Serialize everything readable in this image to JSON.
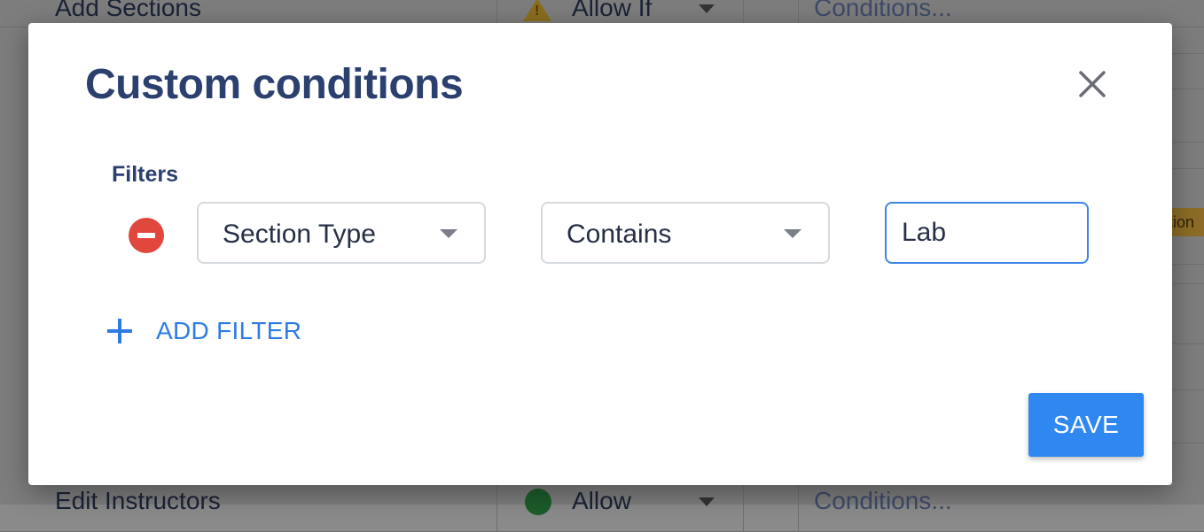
{
  "background": {
    "rows": [
      {
        "label": "Add Sections",
        "permission": "Allow If",
        "conditions": "Conditions...",
        "status_icon": "warning-icon"
      },
      {
        "label": "Edit Instructors",
        "permission": "Allow",
        "conditions": "Conditions...",
        "status_icon": "check-circle-icon"
      }
    ],
    "side_tag": "tion"
  },
  "modal": {
    "title": "Custom conditions",
    "filters_label": "Filters",
    "filters": [
      {
        "field": "Section Type",
        "operator": "Contains",
        "value": "Lab"
      }
    ],
    "add_filter_label": "ADD FILTER",
    "save_label": "SAVE"
  },
  "colors": {
    "title": "#2c4070",
    "accent": "#2f87f0",
    "remove": "#e0483e",
    "input_focus": "#3d86e6"
  }
}
